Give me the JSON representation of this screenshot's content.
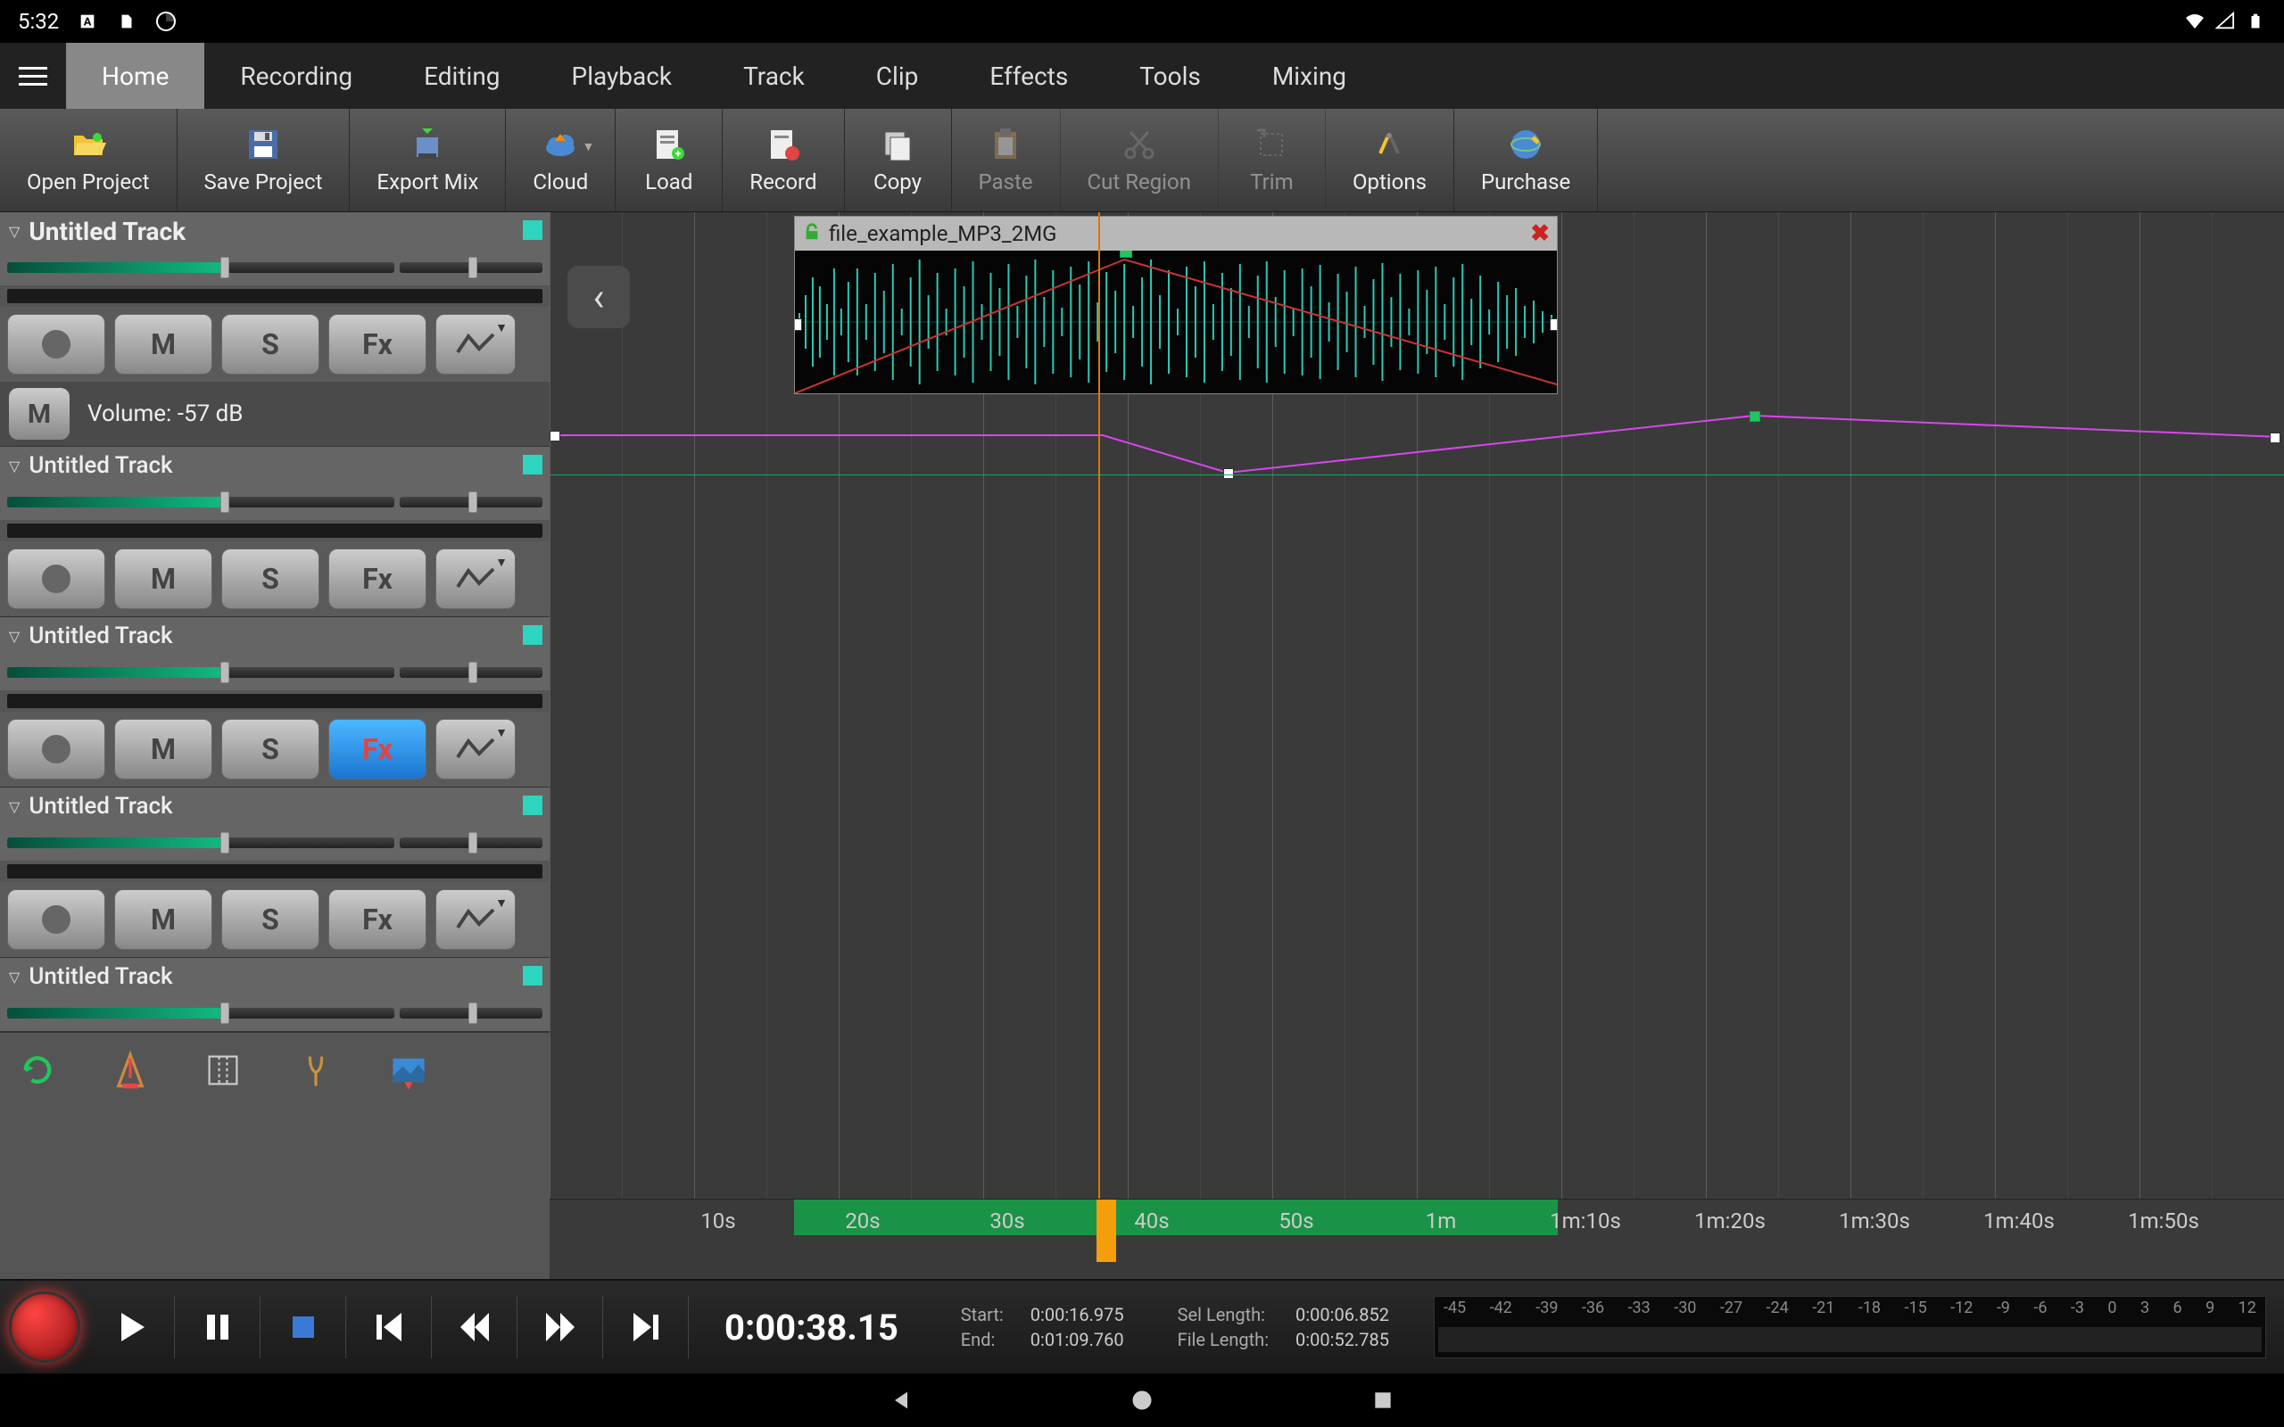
{
  "status_bar": {
    "time": "5:32"
  },
  "menu": {
    "tabs": [
      "Home",
      "Recording",
      "Editing",
      "Playback",
      "Track",
      "Clip",
      "Effects",
      "Tools",
      "Mixing"
    ],
    "active": 0
  },
  "toolbar": {
    "items": [
      {
        "label": "Open Project",
        "icon": "folder",
        "disabled": false
      },
      {
        "label": "Save Project",
        "icon": "save",
        "disabled": false
      },
      {
        "label": "Export Mix",
        "icon": "export",
        "disabled": false
      },
      {
        "label": "Cloud",
        "icon": "cloud",
        "disabled": false,
        "dropdown": true
      },
      {
        "label": "Load",
        "icon": "load",
        "disabled": false
      },
      {
        "label": "Record",
        "icon": "record",
        "disabled": false
      },
      {
        "label": "Copy",
        "icon": "copy",
        "disabled": false
      },
      {
        "label": "Paste",
        "icon": "paste",
        "disabled": true
      },
      {
        "label": "Cut Region",
        "icon": "cut",
        "disabled": true
      },
      {
        "label": "Trim",
        "icon": "trim",
        "disabled": true
      },
      {
        "label": "Options",
        "icon": "options",
        "disabled": false
      },
      {
        "label": "Purchase",
        "icon": "purchase",
        "disabled": false
      }
    ]
  },
  "tracks": [
    {
      "name": "Untitled Track",
      "expanded": true,
      "fx_active": false,
      "volume_lane": {
        "label": "Volume: -57 dB",
        "m": "M"
      }
    },
    {
      "name": "Untitled Track",
      "expanded": true,
      "fx_active": false
    },
    {
      "name": "Untitled Track",
      "expanded": true,
      "fx_active": true
    },
    {
      "name": "Untitled Track",
      "expanded": true,
      "fx_active": false
    },
    {
      "name": "Untitled Track",
      "expanded": false
    }
  ],
  "track_btn": {
    "m": "M",
    "s": "S",
    "fx": "Fx"
  },
  "clip": {
    "name": "file_example_MP3_2MG"
  },
  "timeline": {
    "labels": [
      "10s",
      "20s",
      "30s",
      "40s",
      "50s",
      "1m",
      "1m:10s",
      "1m:20s",
      "1m:30s",
      "1m:40s",
      "1m:50s"
    ]
  },
  "transport": {
    "time": "0:00:38.15",
    "info": {
      "start_label": "Start:",
      "start": "0:00:16.975",
      "end_label": "End:",
      "end": "0:01:09.760",
      "sel_label": "Sel Length:",
      "sel": "0:00:06.852",
      "file_label": "File Length:",
      "file": "0:00:52.785"
    },
    "meter_ticks": [
      "-45",
      "-42",
      "-39",
      "-36",
      "-33",
      "-30",
      "-27",
      "-24",
      "-21",
      "-18",
      "-15",
      "-12",
      "-9",
      "-6",
      "-3",
      "0",
      "3",
      "6",
      "9",
      "12"
    ]
  }
}
